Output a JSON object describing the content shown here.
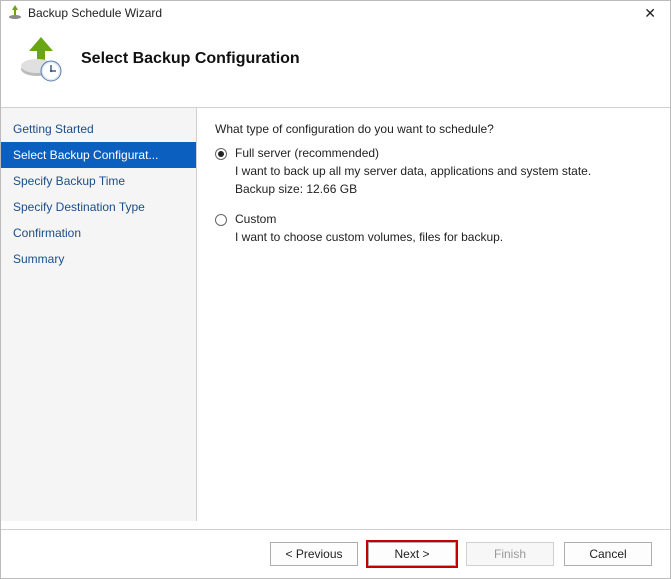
{
  "window": {
    "title": "Backup Schedule Wizard"
  },
  "header": {
    "title": "Select Backup Configuration"
  },
  "sidebar": {
    "items": [
      {
        "label": "Getting Started"
      },
      {
        "label": "Select Backup Configurat..."
      },
      {
        "label": "Specify Backup Time"
      },
      {
        "label": "Specify Destination Type"
      },
      {
        "label": "Confirmation"
      },
      {
        "label": "Summary"
      }
    ],
    "selected_index": 1
  },
  "content": {
    "question": "What type of configuration do you want to schedule?",
    "options": [
      {
        "label": "Full server (recommended)",
        "desc": "I want to back up all my server data, applications and system state.",
        "size_line": "Backup size: 12.66 GB",
        "checked": true
      },
      {
        "label": "Custom",
        "desc": "I want to choose custom volumes, files for backup.",
        "checked": false
      }
    ]
  },
  "footer": {
    "previous": "< Previous",
    "next": "Next >",
    "finish": "Finish",
    "cancel": "Cancel"
  }
}
